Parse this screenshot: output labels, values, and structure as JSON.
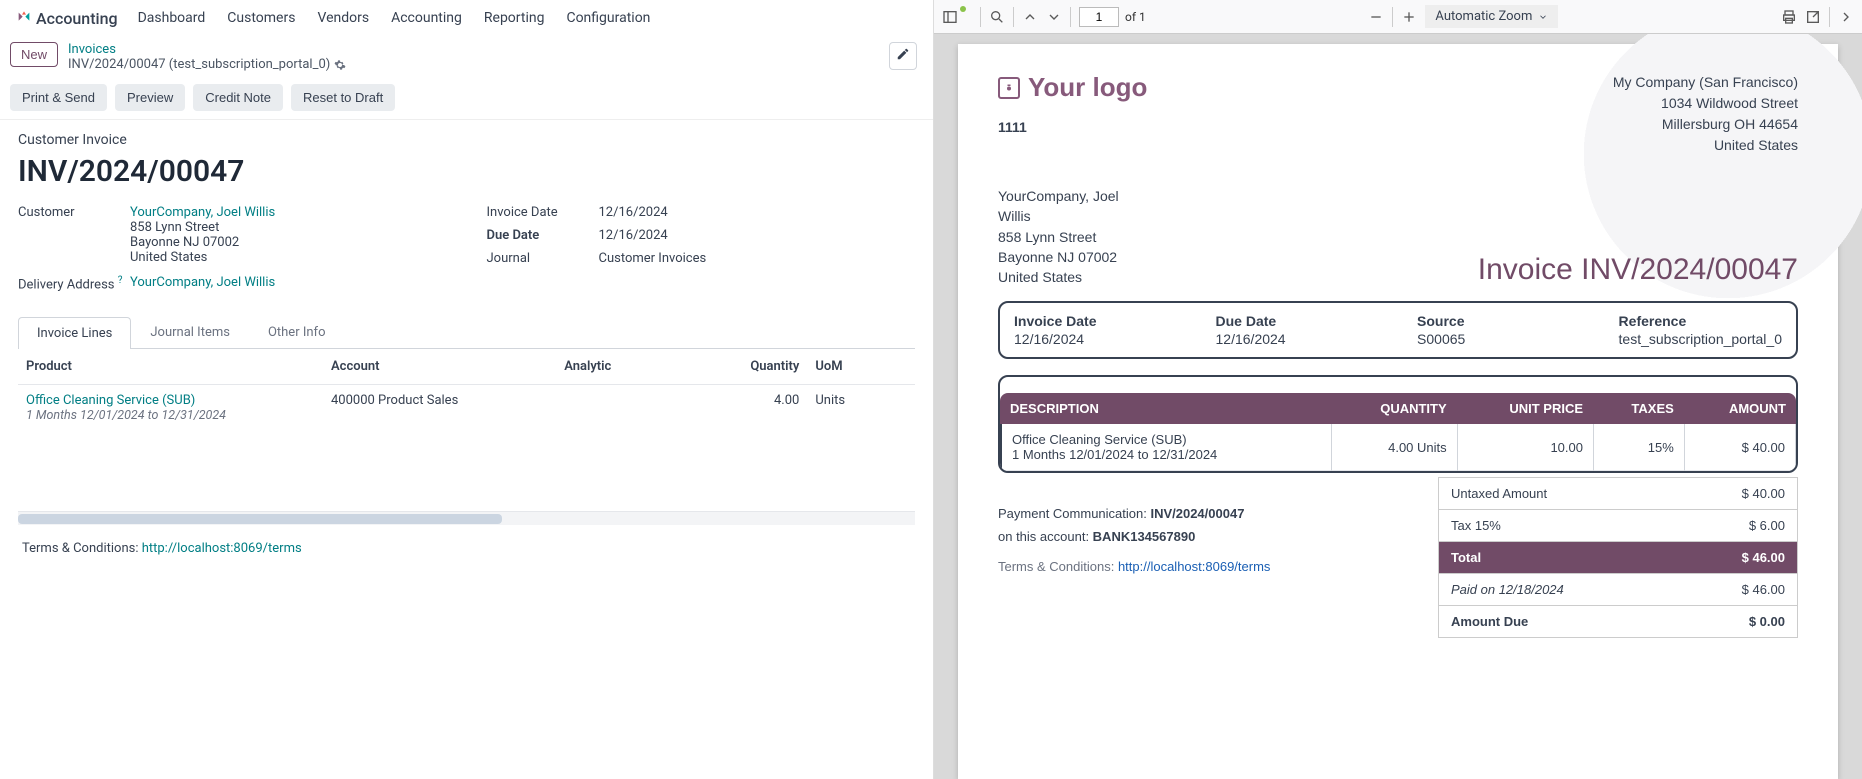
{
  "navbar": {
    "app": "Accounting",
    "menu": [
      "Dashboard",
      "Customers",
      "Vendors",
      "Accounting",
      "Reporting",
      "Configuration"
    ]
  },
  "header": {
    "new_btn": "New",
    "bc_link": "Invoices",
    "bc_current": "INV/2024/00047 (test_subscription_portal_0)"
  },
  "actions": {
    "print_send": "Print & Send",
    "preview": "Preview",
    "credit_note": "Credit Note",
    "reset_draft": "Reset to Draft"
  },
  "form": {
    "type_label": "Customer Invoice",
    "title": "INV/2024/00047",
    "customer_label": "Customer",
    "customer_link": "YourCompany, Joel Willis",
    "customer_addr1": "858 Lynn Street",
    "customer_addr2": "Bayonne NJ 07002",
    "customer_addr3": "United States",
    "delivery_label": "Delivery Address",
    "delivery_link": "YourCompany, Joel Willis",
    "invdate_label": "Invoice Date",
    "invdate_val": "12/16/2024",
    "duedate_label": "Due Date",
    "duedate_val": "12/16/2024",
    "journal_label": "Journal",
    "journal_val": "Customer Invoices"
  },
  "tabs": {
    "lines": "Invoice Lines",
    "journal": "Journal Items",
    "other": "Other Info"
  },
  "cols": {
    "product": "Product",
    "account": "Account",
    "analytic": "Analytic",
    "qty": "Quantity",
    "uom": "UoM"
  },
  "line": {
    "product": "Office Cleaning Service (SUB)",
    "desc": "1 Months 12/01/2024 to 12/31/2024",
    "account": "400000 Product Sales",
    "qty": "4.00",
    "uom": "Units"
  },
  "terms": {
    "label": "Terms & Conditions: ",
    "link": "http://localhost:8069/terms"
  },
  "pdf_toolbar": {
    "page": "1",
    "of": "of 1",
    "zoom": "Automatic Zoom"
  },
  "pdf": {
    "logo_text": "Your logo",
    "company": [
      "My Company (San Francisco)",
      "1034 Wildwood Street",
      "Millersburg OH 44654",
      "United States"
    ],
    "small_id": "1111",
    "bill_to": [
      "YourCompany, Joel",
      "Willis",
      "858 Lynn Street",
      "Bayonne NJ 07002",
      "United States"
    ],
    "inv_title": "Invoice INV/2024/00047",
    "info": {
      "c1l": "Invoice Date",
      "c1v": "12/16/2024",
      "c2l": "Due Date",
      "c2v": "12/16/2024",
      "c3l": "Source",
      "c3v": "S00065",
      "c4l": "Reference",
      "c4v": "test_subscription_portal_0"
    },
    "th": {
      "desc": "DESCRIPTION",
      "qty": "QUANTITY",
      "price": "UNIT PRICE",
      "tax": "TAXES",
      "amt": "AMOUNT"
    },
    "row": {
      "desc1": "Office Cleaning Service (SUB)",
      "desc2": "1 Months 12/01/2024 to 12/31/2024",
      "qty": "4.00 Units",
      "price": "10.00",
      "tax": "15%",
      "amt": "$ 40.00"
    },
    "totals": {
      "untaxed_l": "Untaxed Amount",
      "untaxed_v": "$ 40.00",
      "tax_l": "Tax 15%",
      "tax_v": "$ 6.00",
      "total_l": "Total",
      "total_v": "$ 46.00",
      "paid_l": "Paid on 12/18/2024",
      "paid_v": "$ 46.00",
      "due_l": "Amount Due",
      "due_v": "$ 0.00"
    },
    "paycomm_l": "Payment Communication: ",
    "paycomm_v": "INV/2024/00047",
    "onacct_l": "on this account: ",
    "onacct_v": "BANK134567890",
    "terms_l": "Terms & Conditions: ",
    "terms_link": "http://localhost:8069/terms"
  }
}
